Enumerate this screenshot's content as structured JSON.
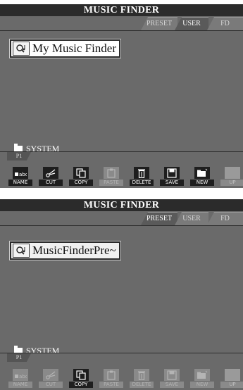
{
  "screens": [
    {
      "title": "MUSIC FINDER",
      "tabs": {
        "preset": "PRESET",
        "user": "USER",
        "fd": "FD"
      },
      "selected_tab": "USER",
      "item_label": "My Music Finder",
      "folder_label": "SYSTEM",
      "page_tab": "P1",
      "buttons": {
        "name": "NAME",
        "cut": "CUT",
        "copy": "COPY",
        "paste": "PASTE",
        "delete": "DELETE",
        "save": "SAVE",
        "new": "NEW",
        "up": "UP"
      },
      "enabled_buttons": [
        "NAME",
        "CUT",
        "COPY",
        "DELETE",
        "SAVE",
        "NEW"
      ]
    },
    {
      "title": "MUSIC FINDER",
      "tabs": {
        "preset": "PRESET",
        "user": "USER",
        "fd": "FD"
      },
      "selected_tab": "PRESET",
      "item_label": "MusicFinderPre~",
      "folder_label": "SYSTEM",
      "page_tab": "P1",
      "buttons": {
        "name": "NAME",
        "cut": "CUT",
        "copy": "COPY",
        "paste": "PASTE",
        "delete": "DELETE",
        "save": "SAVE",
        "new": "NEW",
        "up": "UP"
      },
      "enabled_buttons": [
        "COPY"
      ]
    }
  ],
  "icons": {
    "item": "music-search-icon",
    "folder": "folder-icon",
    "name": "rename-icon",
    "cut": "scissors-icon",
    "copy": "copy-icon",
    "paste": "paste-icon",
    "delete": "trash-icon",
    "save": "disk-icon",
    "new": "new-folder-icon",
    "up": "folder-up-icon"
  }
}
